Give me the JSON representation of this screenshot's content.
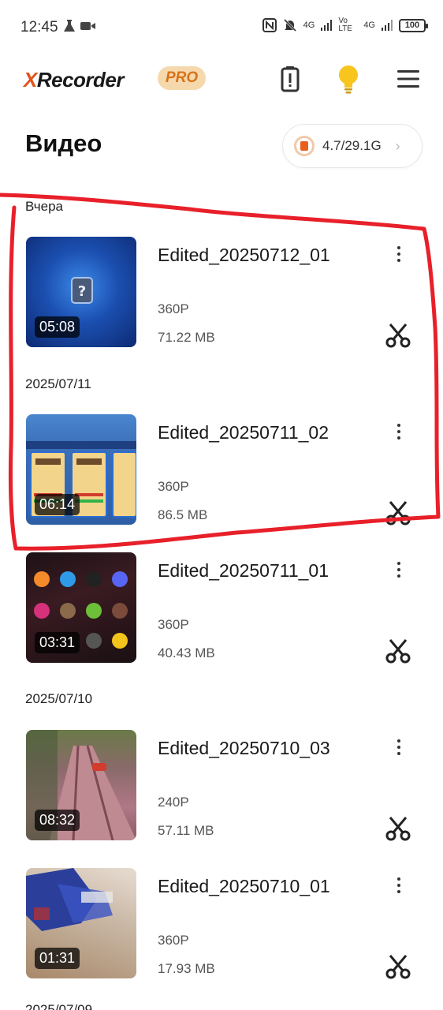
{
  "status": {
    "time": "12:45",
    "net1": "4G",
    "net2": "Vo LTE",
    "net3": "4G",
    "battery": "100"
  },
  "header": {
    "logo_x": "X",
    "logo_rest": "Recorder",
    "pro": "PRO",
    "icons": [
      "battery-alert-icon",
      "lightbulb-icon",
      "menu-icon"
    ]
  },
  "page": {
    "title": "Видео",
    "storage": "4.7/29.1G"
  },
  "sections": [
    {
      "date": "Вчера"
    },
    {
      "date": "2025/07/11"
    },
    {
      "date": "2025/07/10"
    },
    {
      "date": "2025/07/09"
    }
  ],
  "videos": [
    {
      "title": "Edited_20250712_01",
      "resolution": "360P",
      "size": "71.22 MB",
      "duration": "05:08"
    },
    {
      "title": "Edited_20250711_02",
      "resolution": "360P",
      "size": "86.5 MB",
      "duration": "06:14"
    },
    {
      "title": "Edited_20250711_01",
      "resolution": "360P",
      "size": "40.43 MB",
      "duration": "03:31"
    },
    {
      "title": "Edited_20250710_03",
      "resolution": "240P",
      "size": "57.11 MB",
      "duration": "08:32"
    },
    {
      "title": "Edited_20250710_01",
      "resolution": "360P",
      "size": "17.93 MB",
      "duration": "01:31"
    }
  ],
  "colors": {
    "brand_orange": "#e2531b",
    "annotation_red": "#e8202a"
  }
}
